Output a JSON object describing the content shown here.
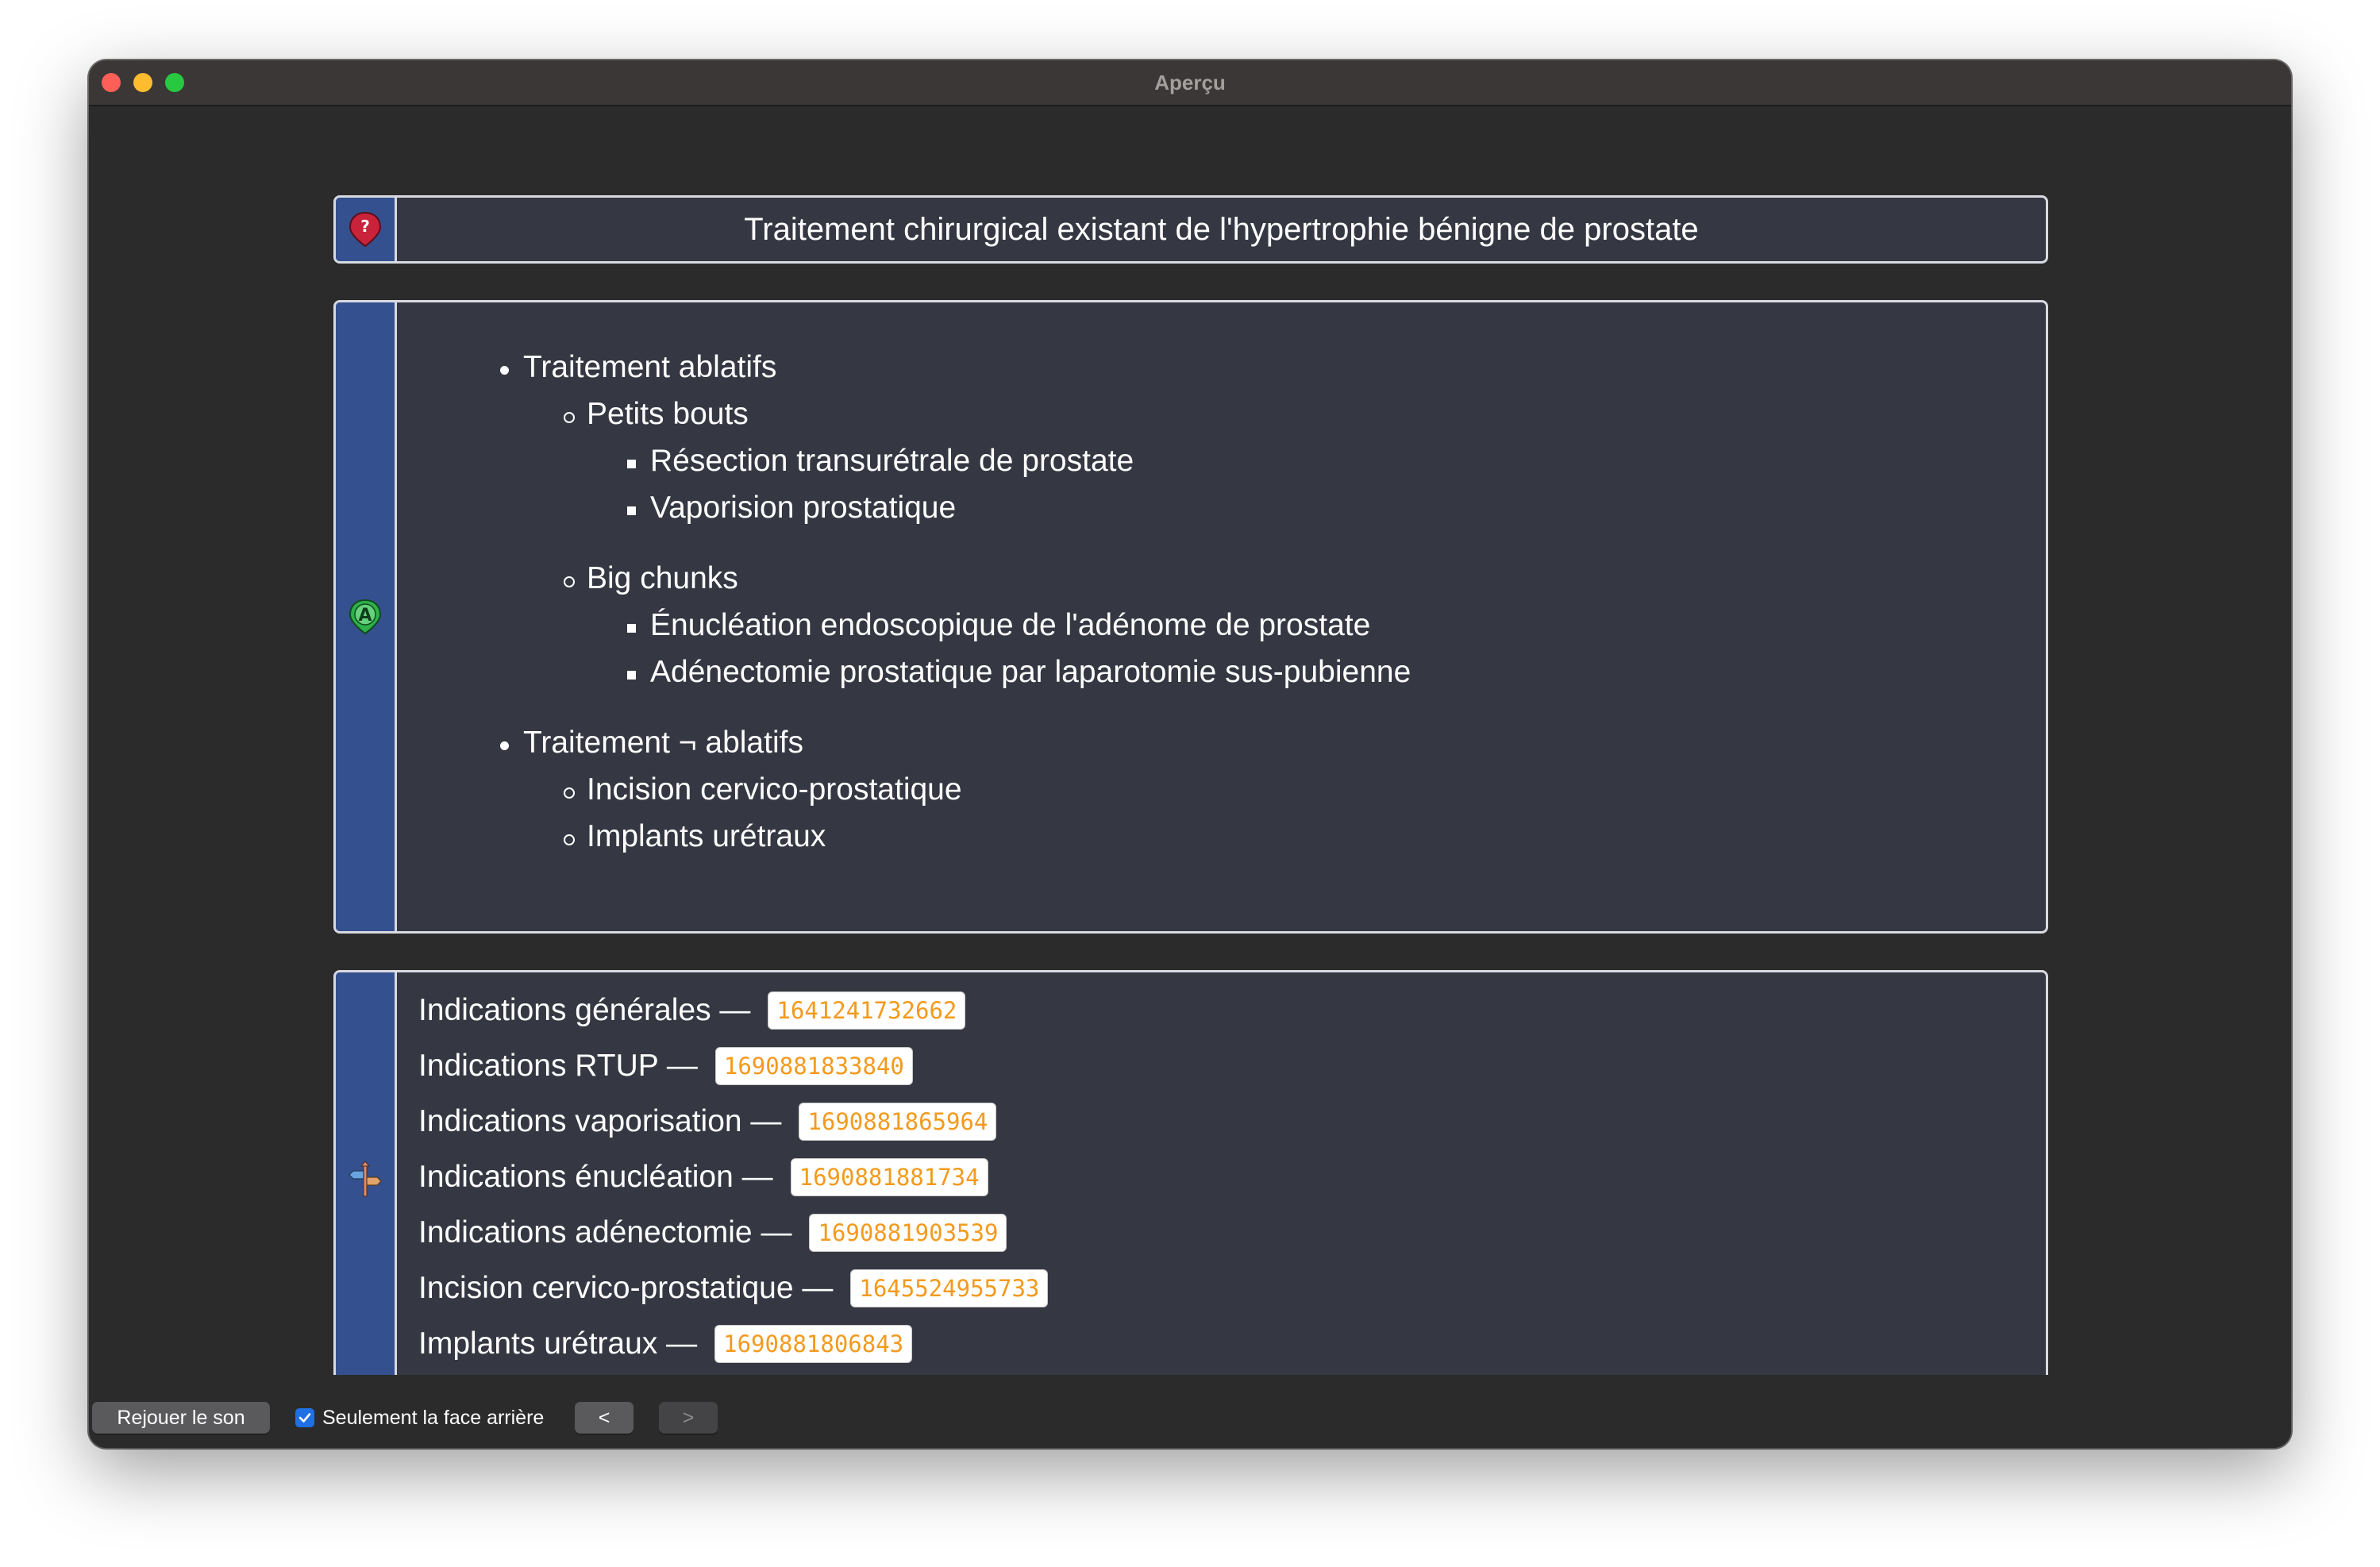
{
  "window": {
    "title": "Aperçu"
  },
  "question": {
    "text": "Traitement chirurgical existant de l'hypertrophie bénigne de prostate",
    "icon": "question-pin-icon"
  },
  "answer": {
    "icon": "letter-a-pin-icon",
    "items": [
      "Traitement ablatifs",
      "Petits bouts",
      "Résection transurétrale de prostate",
      "Vaporision prostatique",
      "Big chunks",
      "Énucléation endoscopique de l'adénome de prostate",
      "Adénectomie prostatique par laparotomie sus-pubienne",
      "Traitement ¬ ablatifs",
      "Incision cervico-prostatique",
      "Implants urétraux"
    ]
  },
  "links": {
    "icon": "signpost-icon",
    "items": [
      {
        "label": "Indications générales —",
        "id": "1641241732662"
      },
      {
        "label": "Indications RTUP —",
        "id": "1690881833840"
      },
      {
        "label": "Indications vaporisation —",
        "id": "1690881865964"
      },
      {
        "label": "Indications énucléation —",
        "id": "1690881881734"
      },
      {
        "label": "Indications adénectomie —",
        "id": "1690881903539"
      },
      {
        "label": "Incision cervico-prostatique —",
        "id": "1645524955733"
      },
      {
        "label": "Implants urétraux —",
        "id": "1690881806843"
      }
    ]
  },
  "controls": {
    "replay_label": "Rejouer le son",
    "backside_only_label": "Seulement la face arrière",
    "backside_only_checked": true,
    "prev_label": "<",
    "next_label": ">"
  }
}
